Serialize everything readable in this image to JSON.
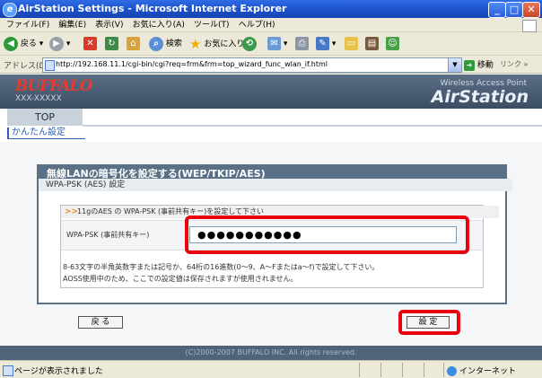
{
  "window": {
    "title": "AirStation Settings - Microsoft Internet Explorer",
    "min_glyph": "_",
    "max_glyph": "□",
    "close_glyph": "✕"
  },
  "menu": [
    "ファイル(F)",
    "編集(E)",
    "表示(V)",
    "お気に入り(A)",
    "ツール(T)",
    "ヘルプ(H)"
  ],
  "toolbar": {
    "back_label": "戻る",
    "search_label": "検索",
    "favorites_label": "お気に入り"
  },
  "address": {
    "label": "アドレス(D)",
    "url": "http://192.168.11.1/cgi-bin/cgi?req=frm&frm=top_wizard_func_wlan_if.html",
    "go_label": "移動",
    "links_label": "リンク »"
  },
  "banner": {
    "logo": "BUFFALO",
    "model": "XXX-XXXXX",
    "subtitle": "Wireless Access Point",
    "product": "AirStation"
  },
  "nav": {
    "top_tab": "TOP",
    "current": "かんたん設定"
  },
  "panel": {
    "heading": "無線LANの暗号化を設定する(WEP/TKIP/AES)",
    "subheading": "WPA-PSK (AES) 設定",
    "hint_arrow": ">>",
    "hint": "11gのAES の WPA-PSK (事前共有キー)を設定して下さい",
    "field_label": "WPA-PSK (事前共有キー)",
    "field_value": "●●●●●●●●●●●",
    "note_line1": "8-63文字の半角英数字または記号か、64桁の16進数(0〜9、A〜Fまたはa〜f)で設定して下さい。",
    "note_line2": "AOSS使用中のため、ここでの設定値は保存されますが使用されません。"
  },
  "buttons": {
    "back": "戻 る",
    "set": "設 定"
  },
  "footer": "(C)2000-2007 BUFFALO INC. All rights reserved.",
  "status": {
    "text": "ページが表示されました",
    "zone": "インターネット"
  },
  "colors": {
    "highlight": "#e8000d",
    "panel": "#5a7087",
    "banner": "#3b4d63"
  }
}
